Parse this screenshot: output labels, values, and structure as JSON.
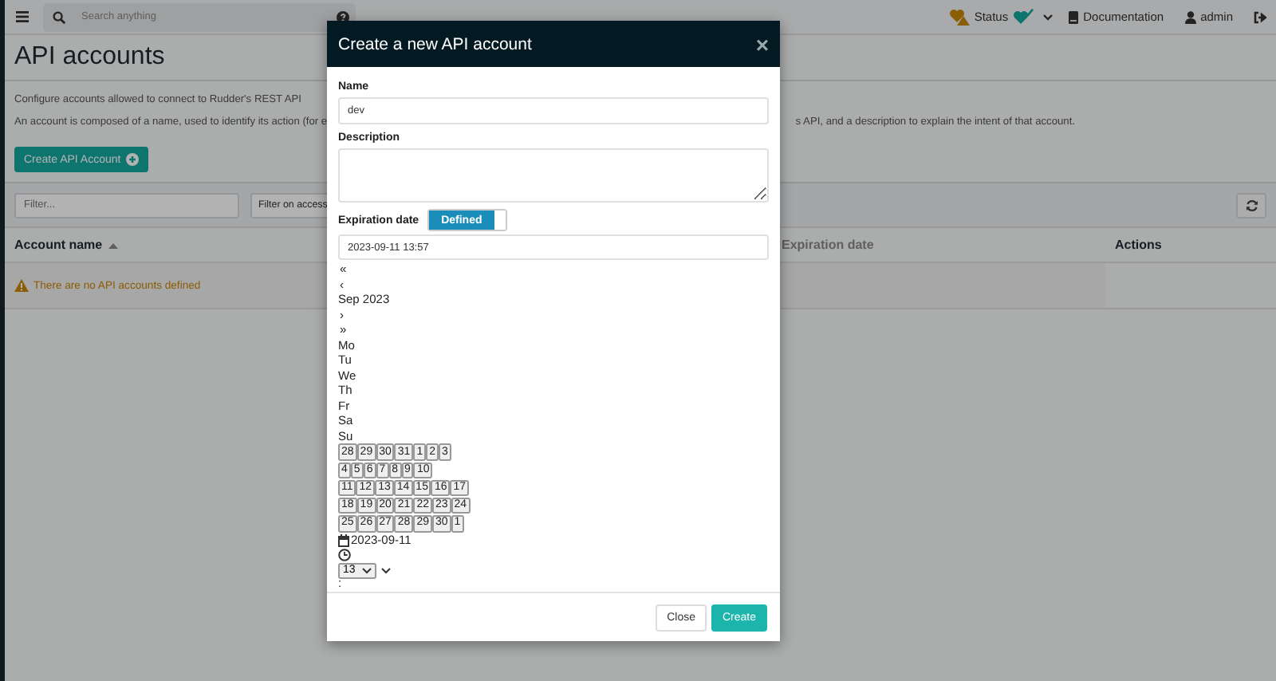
{
  "topbar": {
    "search_placeholder": "Search anything",
    "status_label": "Status",
    "documentation": "Documentation",
    "user": "admin"
  },
  "page": {
    "title": "API accounts",
    "intro": "Configure accounts allowed to connect to Rudder's REST API",
    "description_start": "An account is composed of a name, used to identify its action (for e",
    "description_end": "s API, and a description to explain the intent of that account.",
    "create_button": "Create API Account",
    "filter_placeholder": "Filter...",
    "access_filter": "Filter on access"
  },
  "table": {
    "columns": [
      {
        "label": "Account name",
        "sorted": true
      },
      {
        "label": "Expiration date",
        "sorted": false
      },
      {
        "label": "Actions",
        "sorted": false
      }
    ],
    "empty_message": "There are no API accounts defined"
  },
  "modal": {
    "title": "Create a new API account",
    "close": "×",
    "name_label": "Name",
    "name_value": "dev",
    "description_label": "Description",
    "expiration_label": "Expiration date",
    "expiration_toggle": {
      "label": "Defined",
      "on": true
    },
    "expiration_value": "2023-09-11 13:57",
    "calendar": {
      "prev_year": "«",
      "prev_month": "‹",
      "month": "Sep 2023",
      "next_month": "›",
      "next_year": "»",
      "weekdays": [
        "Mo",
        "Tu",
        "We",
        "Th",
        "Fr",
        "Sa",
        "Su"
      ],
      "weeks": [
        [
          "28",
          "29",
          "30",
          "31",
          "1",
          "2",
          "3"
        ],
        [
          "4",
          "5",
          "6",
          "7",
          "8",
          "9",
          "10"
        ],
        [
          "11",
          "12",
          "13",
          "14",
          "15",
          "16",
          "17"
        ],
        [
          "18",
          "19",
          "20",
          "21",
          "22",
          "23",
          "24"
        ],
        [
          "25",
          "26",
          "27",
          "28",
          "29",
          "30",
          "1"
        ]
      ],
      "date": "2023-09-11",
      "hour": "13",
      "separator": ":"
    },
    "buttons": [
      {
        "label": "Close",
        "kind": "secondary"
      },
      {
        "label": "Create",
        "kind": "primary"
      }
    ]
  }
}
